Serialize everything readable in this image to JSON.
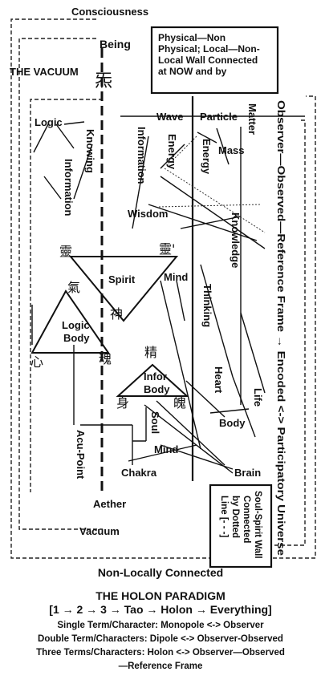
{
  "labels": {
    "consciousness": "Consciousness",
    "being": "Being",
    "the_vacuum": "THE VACUUM",
    "logic": "Logic",
    "knowing": "Knowing",
    "information_left": "Information",
    "wave": "Wave",
    "particle": "Particle",
    "matter": "Matter",
    "information_center": "Information",
    "energy_1": "Energy",
    "energy_2": "Energy",
    "mass": "Mass",
    "wisdom": "Wisdom",
    "knowledge": "Knowledge",
    "spirit": "Spirit",
    "mind_upper": "Mind",
    "logic_body_1": "Logic",
    "logic_body_2": "Body",
    "thinking": "Thinking",
    "infor_body_1": "Infor",
    "infor_body_2": "Body",
    "life": "Life",
    "heart": "Heart",
    "body_dash": "Body",
    "soul": "Soul",
    "mind_lower": "Mind",
    "acu_point": "Acu-Point",
    "chakra": "Chakra",
    "brain": "Brain",
    "aether": "Aether",
    "vacuum": "Vacuum",
    "right_vertical": "Observer—Observed—Reference Frame → Encoded <-> Participatory Universe",
    "soul_spirit_wall": "Soul-Spirit Wall",
    "connected": "Connected",
    "by_dotted": "by Dotted",
    "line_dotted": "Line [- - -]"
  },
  "cjk": {
    "top_glyph": "炁",
    "ling_left": "靈",
    "ling_right": "靈'",
    "qi": "氣",
    "shen": "神",
    "jing": "精",
    "xin": "心",
    "hun": "魂",
    "shen_body": "身",
    "po": "魄"
  },
  "top_box": [
    "Physical—Non",
    "Physical; Local—Non-",
    "Local Wall Connected",
    "at NOW and by"
  ],
  "footer": {
    "non_locally": "Non-Locally Connected",
    "title": "THE HOLON PARADIGM",
    "sequence": "[1 → 2 → 3 → Tao → Holon → Everything]",
    "line1": "Single Term/Character: Monopole <-> Observer",
    "line2": "Double Term/Characters: Dipole <-> Observer-Observed",
    "line3": "Three Terms/Characters: Holon <-> Observer—Observed",
    "line4": "—Reference Frame"
  }
}
